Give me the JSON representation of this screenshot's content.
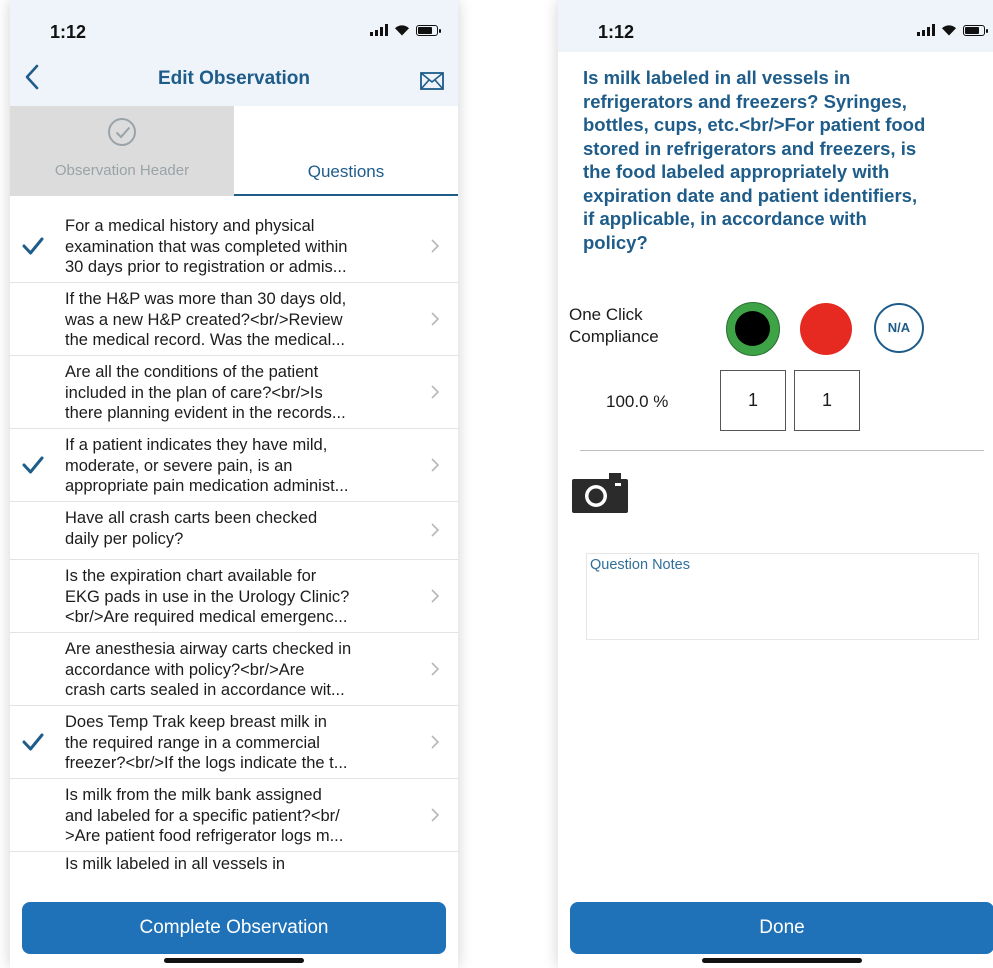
{
  "left": {
    "status": {
      "time": "1:12"
    },
    "nav": {
      "title": "Edit Observation",
      "back_icon": "chevron-left-icon",
      "mail_icon": "mail-icon"
    },
    "tabs": [
      {
        "label": "Observation Header",
        "icon": "check-circle-icon",
        "selected": false
      },
      {
        "label": "Questions",
        "selected": true
      }
    ],
    "questions": [
      {
        "text": "For a medical history and physical\nexamination that was completed within\n30 days prior to registration or admis...",
        "checked": true
      },
      {
        "text": "If the H&P was more than 30 days old,\nwas a new H&P created?<br/>Review\nthe medical record. Was the medical...",
        "checked": false
      },
      {
        "text": "Are all the conditions of the patient\nincluded in the plan of care?<br/>Is\nthere planning evident in the records...",
        "checked": false
      },
      {
        "text": "If a patient indicates they have mild,\nmoderate, or severe pain, is an\nappropriate pain medication administ...",
        "checked": true
      },
      {
        "text": "Have all crash carts been checked\ndaily per policy?",
        "checked": false
      },
      {
        "text": "Is the expiration chart available for\nEKG pads in use in the Urology Clinic?\n<br/>Are required medical emergenc...",
        "checked": false
      },
      {
        "text": "Are anesthesia airway carts checked in\naccordance with policy?<br/>Are\ncrash carts sealed in accordance wit...",
        "checked": false
      },
      {
        "text": "Does Temp Trak keep breast milk in\nthe required range in a commercial\nfreezer?<br/>If the logs indicate the t...",
        "checked": true
      },
      {
        "text": "Is milk from the milk bank assigned\nand labeled for a specific patient?<br/\n>Are patient food refrigerator logs m...",
        "checked": false
      },
      {
        "text": "Is milk labeled in all vessels in",
        "checked": false
      }
    ],
    "complete_button": "Complete Observation"
  },
  "right": {
    "status": {
      "time": "1:12"
    },
    "question_title": "Is milk labeled in all vessels in\nrefrigerators and freezers?  Syringes,\nbottles, cups, etc.<br/>For patient food\nstored in refrigerators and freezers, is\nthe food labeled appropriately with\nexpiration date and patient identifiers,\nif applicable, in accordance with\npolicy?",
    "one_click": {
      "label": "One Click\nCompliance",
      "na_label": "N/A"
    },
    "score": {
      "percent": "100.0 %",
      "value_a": "1",
      "value_b": "1"
    },
    "camera_icon": "camera-icon",
    "notes_placeholder": "Question Notes",
    "done_button": "Done"
  },
  "colors": {
    "accent": "#1e5c8a",
    "button": "#1f72b8",
    "compliant": "#3ea346",
    "noncompliant": "#e62a22"
  }
}
